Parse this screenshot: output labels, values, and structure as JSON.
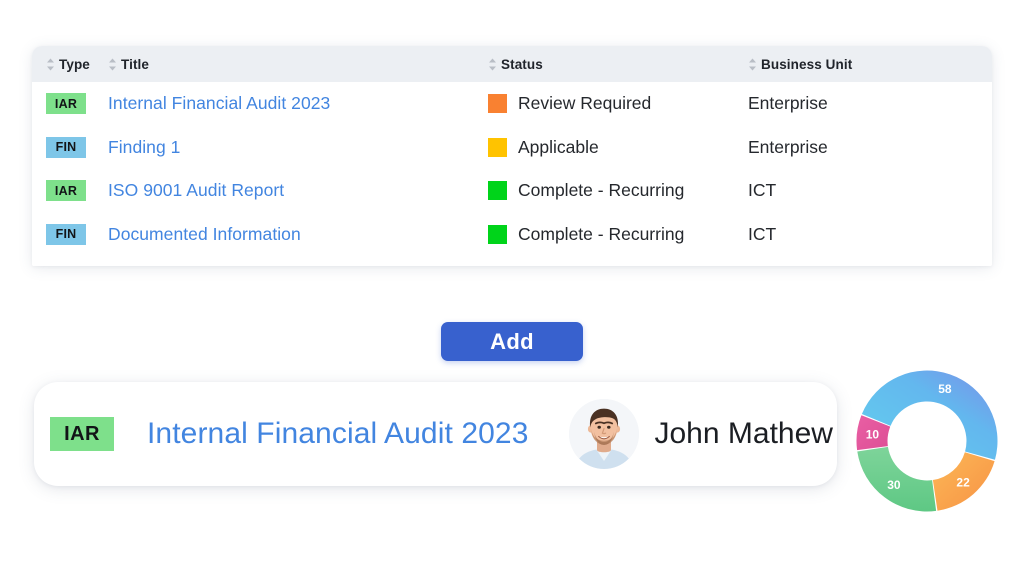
{
  "table": {
    "columns": [
      {
        "key": "type",
        "label": "Type",
        "sortable": true
      },
      {
        "key": "title",
        "label": "Title",
        "sortable": true
      },
      {
        "key": "status",
        "label": "Status",
        "sortable": true
      },
      {
        "key": "business_unit",
        "label": "Business Unit",
        "sortable": true
      }
    ],
    "rows": [
      {
        "type": "IAR",
        "type_color": "#7ee08b",
        "title": "Internal Financial Audit 2023",
        "status": "Review Required",
        "status_color": "#f98131",
        "business_unit": "Enterprise"
      },
      {
        "type": "FIN",
        "type_color": "#7ec6e8",
        "title": "Finding 1",
        "status": "Applicable",
        "status_color": "#ffc300",
        "business_unit": "Enterprise"
      },
      {
        "type": "IAR",
        "type_color": "#7ee08b",
        "title": "ISO 9001 Audit Report",
        "status": "Complete - Recurring",
        "status_color": "#00d41a",
        "business_unit": "ICT"
      },
      {
        "type": "FIN",
        "type_color": "#7ec6e8",
        "title": "Documented Information",
        "status": "Complete - Recurring",
        "status_color": "#00d41a",
        "business_unit": "ICT"
      }
    ]
  },
  "toolbar": {
    "add_label": "Add",
    "add_color": "#3861ce"
  },
  "detail": {
    "type": "IAR",
    "type_color": "#7ee08b",
    "title": "Internal Financial Audit 2023",
    "title_color": "#4285e0",
    "user_name": "John Mathew"
  },
  "chart_data": {
    "type": "pie",
    "variant": "donut",
    "title": "",
    "labels": [
      "58",
      "22",
      "30",
      "10"
    ],
    "values": [
      58,
      22,
      30,
      10
    ],
    "colors": [
      "#61c7ef",
      "#f9a94b",
      "#6dcf8a",
      "#e8589f"
    ],
    "label_position": "inside",
    "legend": "none",
    "grid": false,
    "inner_radius_ratio": 0.56
  }
}
